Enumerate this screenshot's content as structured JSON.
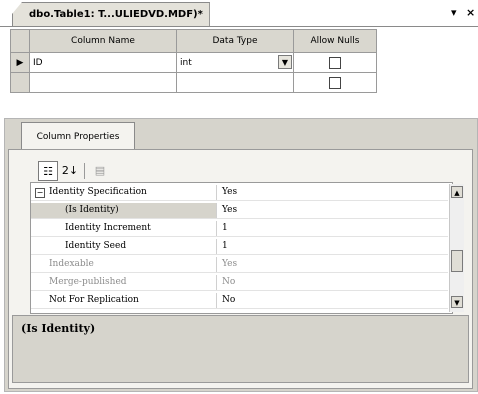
{
  "document_tab": {
    "title": "dbo.Table1: T...ULIEDVD.MDF)*",
    "dropdown_glyph": "▾",
    "close_glyph": "×"
  },
  "columns_grid": {
    "headers": [
      "Column Name",
      "Data Type",
      "Allow Nulls"
    ],
    "rows": [
      {
        "indicator": "▶",
        "column_name": "ID",
        "data_type": "int",
        "allow_nulls": false
      },
      {
        "indicator": "",
        "column_name": "",
        "data_type": "",
        "allow_nulls": false
      }
    ],
    "dropdown_glyph": "▼"
  },
  "column_properties": {
    "tab_label": "Column Properties",
    "toolbar": [
      {
        "name": "categorized",
        "glyph": "☷",
        "active": true
      },
      {
        "name": "alphabetical",
        "glyph": "2↓",
        "active": false
      },
      {
        "name": "property-pages",
        "glyph": "▤",
        "active": false
      }
    ],
    "properties": [
      {
        "name": "Identity Specification",
        "value": "Yes",
        "expander": "⊟",
        "indent": false,
        "disabled": false,
        "selected": false
      },
      {
        "name": "(Is Identity)",
        "value": "Yes",
        "indent": true,
        "disabled": false,
        "selected": true
      },
      {
        "name": "Identity Increment",
        "value": "1",
        "indent": true,
        "disabled": false,
        "selected": false
      },
      {
        "name": "Identity Seed",
        "value": "1",
        "indent": true,
        "disabled": false,
        "selected": false
      },
      {
        "name": "Indexable",
        "value": "Yes",
        "indent": false,
        "disabled": true,
        "selected": false
      },
      {
        "name": "Merge-published",
        "value": "No",
        "indent": false,
        "disabled": true,
        "selected": false
      },
      {
        "name": "Not For Replication",
        "value": "No",
        "indent": false,
        "disabled": false,
        "selected": false
      }
    ],
    "scroll_up_glyph": "▲",
    "scroll_down_glyph": "▼",
    "description_title": "(Is Identity)"
  }
}
